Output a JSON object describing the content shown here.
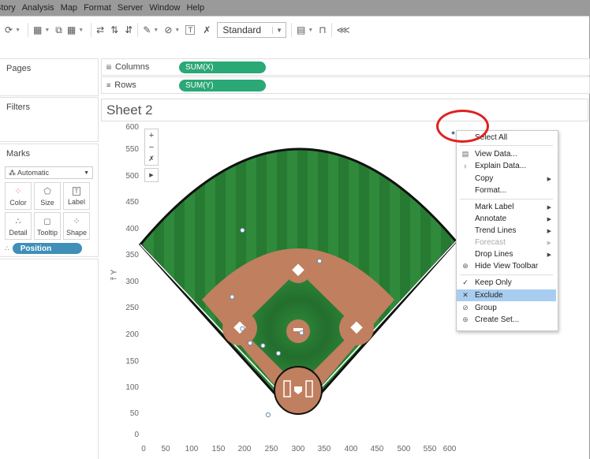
{
  "menu": [
    "Story",
    "Analysis",
    "Map",
    "Format",
    "Server",
    "Window",
    "Help"
  ],
  "toolbar": {
    "fit_dropdown": "Standard"
  },
  "pages": {
    "title": "Pages"
  },
  "filters": {
    "title": "Filters"
  },
  "shelves": {
    "columns_label": "Columns",
    "columns_pill": "SUM(X)",
    "rows_label": "Rows",
    "rows_pill": "SUM(Y)"
  },
  "marks": {
    "title": "Marks",
    "mark_type": "Automatic",
    "buttons": [
      "Color",
      "Size",
      "Label",
      "Detail",
      "Tooltip",
      "Shape"
    ],
    "field_pill": "Position"
  },
  "sheet": {
    "title": "Sheet 2"
  },
  "chart": {
    "ylabel": "Y",
    "y_ticks": [
      "600",
      "550",
      "500",
      "450",
      "400",
      "350",
      "300",
      "250",
      "200",
      "150",
      "100",
      "50",
      "0"
    ],
    "x_ticks": [
      "0",
      "50",
      "100",
      "150",
      "200",
      "250",
      "300",
      "350",
      "400",
      "450",
      "500",
      "550",
      "600"
    ],
    "colors": {
      "grass": "#2f8a3b",
      "dirt": "#c07f5f",
      "pill": "#2aa876",
      "highlight": "#a9cdf0",
      "annotation": "#e02020"
    }
  },
  "chart_data": {
    "type": "scatter",
    "xlabel": "",
    "ylabel": "Y",
    "xlim": [
      0,
      600
    ],
    "ylim": [
      0,
      600
    ],
    "points": [
      {
        "x": 200,
        "y": 400
      },
      {
        "x": 350,
        "y": 340
      },
      {
        "x": 180,
        "y": 270
      },
      {
        "x": 200,
        "y": 208
      },
      {
        "x": 215,
        "y": 180
      },
      {
        "x": 240,
        "y": 175
      },
      {
        "x": 270,
        "y": 160
      },
      {
        "x": 315,
        "y": 200
      },
      {
        "x": 250,
        "y": 40
      },
      {
        "x": 610,
        "y": 590
      }
    ]
  },
  "context_menu": {
    "items": [
      {
        "label": "Select All",
        "icon": "",
        "arrow": false
      },
      {
        "label": "View Data...",
        "icon": "table-icon",
        "arrow": false
      },
      {
        "label": "Explain Data...",
        "icon": "lightbulb-icon",
        "arrow": false
      },
      {
        "label": "Copy",
        "icon": "",
        "arrow": true
      },
      {
        "label": "Format...",
        "icon": "",
        "arrow": false
      },
      {
        "label": "Mark Label",
        "icon": "",
        "arrow": true
      },
      {
        "label": "Annotate",
        "icon": "",
        "arrow": true
      },
      {
        "label": "Trend Lines",
        "icon": "",
        "arrow": true
      },
      {
        "label": "Forecast",
        "icon": "",
        "arrow": true,
        "disabled": true
      },
      {
        "label": "Drop Lines",
        "icon": "",
        "arrow": true
      },
      {
        "label": "Hide View Toolbar",
        "icon": "zoom-icon",
        "arrow": false
      },
      {
        "label": "Keep Only",
        "icon": "check-icon",
        "arrow": false
      },
      {
        "label": "Exclude",
        "icon": "x-icon",
        "arrow": false,
        "active": true
      },
      {
        "label": "Group",
        "icon": "paperclip-icon",
        "arrow": false
      },
      {
        "label": "Create Set...",
        "icon": "set-icon",
        "arrow": false
      }
    ]
  }
}
